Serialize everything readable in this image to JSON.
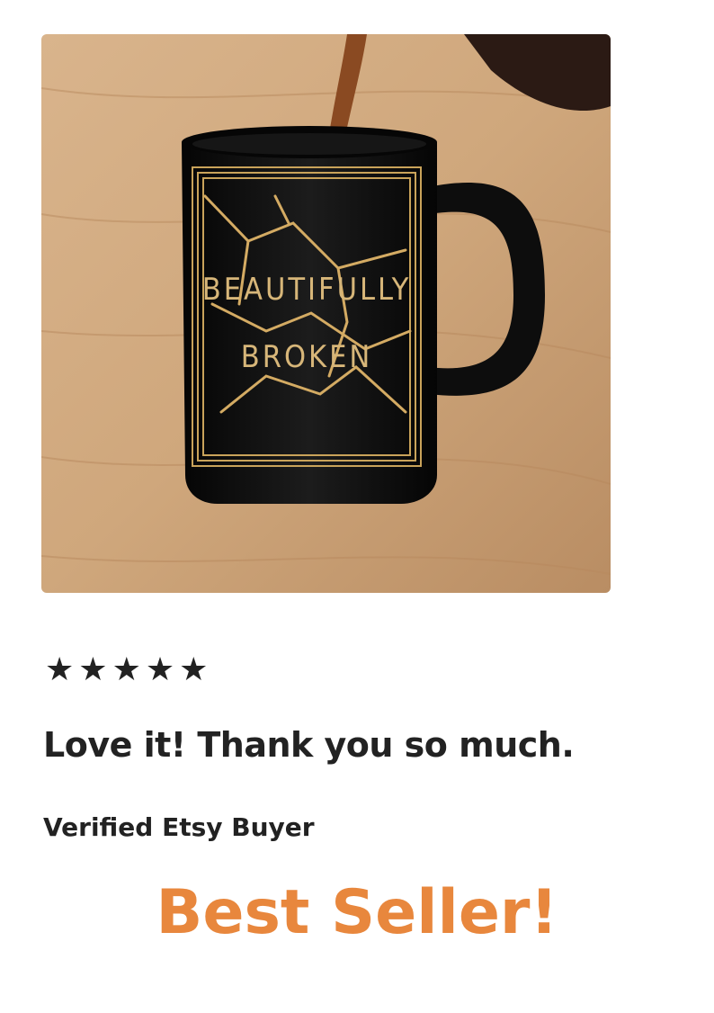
{
  "product_image": {
    "mug_text_line1": "BEAUTIFULLY",
    "mug_text_line2": "BROKEN"
  },
  "review": {
    "rating": 5,
    "rating_max": 5,
    "star_glyph": "★",
    "text": "Love it! Thank you so much.",
    "reviewer": "Verified Etsy Buyer"
  },
  "promo": {
    "label": "Best Seller!",
    "color": "#e8873d"
  },
  "colors": {
    "text": "#222222",
    "mug": "#0e0e0e",
    "gold": "#c9a35a"
  }
}
